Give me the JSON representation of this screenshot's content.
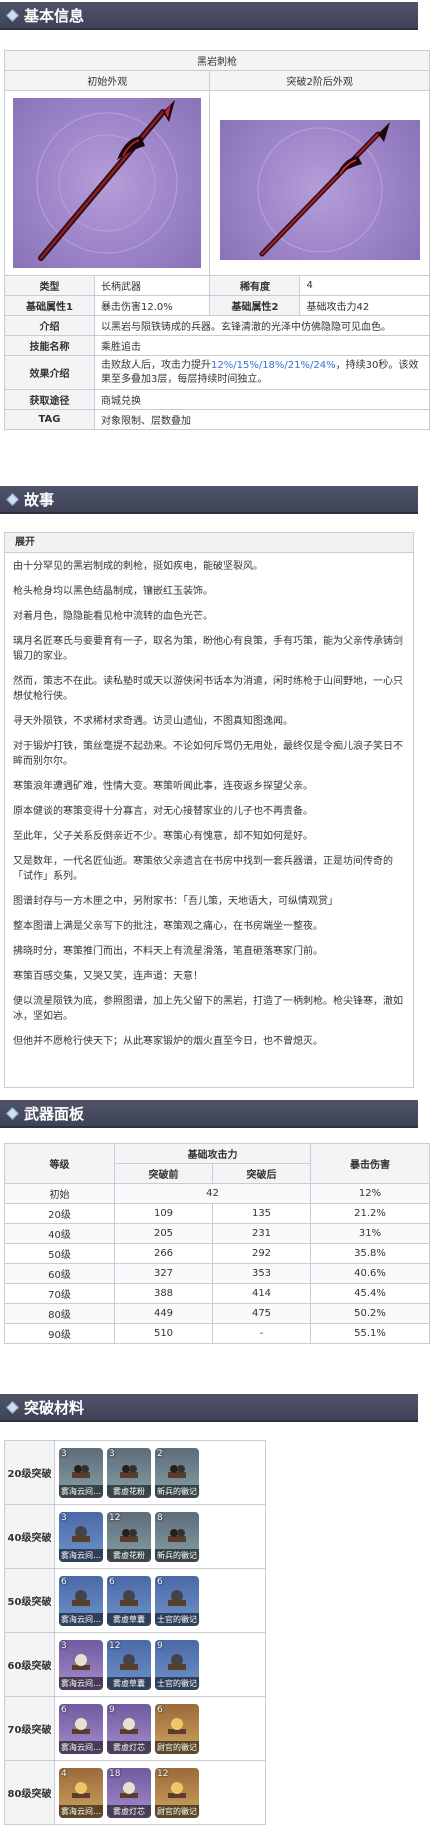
{
  "sections": {
    "basic": "基本信息",
    "story": "故事",
    "panel": "武器面板",
    "materials": "突破材料"
  },
  "info": {
    "name": "黑岩刺枪",
    "initial_label": "初始外观",
    "ascended_label": "突破2阶后外观",
    "type_label": "类型",
    "type_value": "长柄武器",
    "rarity_label": "稀有度",
    "rarity_value": "4",
    "attr1_label": "基础属性1",
    "attr1_value": "暴击伤害12.0%",
    "attr2_label": "基础属性2",
    "attr2_value": "基础攻击力42",
    "intro_label": "介绍",
    "intro_value": "以黑岩与陨铁铸成的兵器。玄锋清澈的光泽中仿佛隐隐可见血色。",
    "skill_label": "技能名称",
    "skill_value": "乘胜追击",
    "effect_label": "效果介绍",
    "effect_pre": "击败敌人后，攻击力提升",
    "effect_hl": "12%/15%/18%/21%/24%",
    "effect_post": "，持续30秒。该效果至多叠加3层，每层持续时间独立。",
    "source_label": "获取途径",
    "source_value": "商城兑换",
    "tag_label": "TAG",
    "tag_value": "对象限制、层数叠加"
  },
  "story": {
    "toggle": "展开",
    "lines": [
      "由十分罕见的黑岩制成的刺枪，挺如疾电，能破坚裂风。",
      "枪头枪身均以黑色结晶制成，镶嵌红玉装饰。",
      "对着月色，隐隐能看见枪中流转的血色光芒。",
      "璃月名匠寒氏与妾要育有一子，取名为策，盼他心有良策，手有巧策，能为父亲传承铸剑锻刀的家业。",
      "然而，策志不在此。读私塾时或天以游侠闲书话本为消遣，闲时练枪于山间野地，一心只想仗枪行侠。",
      "寻天外陨铁，不求稀材求奇遇。访灵山遗仙，不图真知图逸闻。",
      "对于锻炉打铁，策丝毫提不起劲来。不论如何斥骂仍无用处，最终仅是令痴儿浪子笑日不眸而别尔尔。",
      "寒策浪年遭遇矿难，性情大变。寒策听闻此事，连夜返乡探望父亲。",
      "原本健谈的寒策变得十分寡言，对无心接替家业的儿子也不再责备。",
      "至此年，父子关系反倒亲近不少。寒策心有愧意，却不知如何是好。",
      "又是数年，一代名匠仙逝。寒策依父亲遗言在书房中找到一套兵器谱，正是坊间传奇的「试作」系列。",
      "图谱封存与一方木匣之中，另附家书：「吾儿策，天地语大，可纵情观赏」",
      "整本图谱上满是父亲写下的批注，寒策观之痛心，在书房端坐一整夜。",
      "拂晓时分，寒策推门而出，不料天上有流星滑落，笔直砸落寒家门前。",
      "寒策百感交集，又哭又笑，连声道：天意！",
      "便以流星陨铁为底，参照图谱，加上先父留下的黑岩，打造了一柄刺枪。枪尖锋寒，澈如冰，坚如岩。",
      "但他并不愿枪行侠天下；从此寒家锻炉的烟火直至今日，也不曾熄灭。"
    ]
  },
  "stats": {
    "col_level": "等级",
    "col_atk": "基础攻击力",
    "col_before": "突破前",
    "col_after": "突破后",
    "col_crit": "暴击伤害",
    "rows": [
      {
        "level": "初始",
        "before": "42",
        "after": "",
        "crit": "12%"
      },
      {
        "level": "20级",
        "before": "109",
        "after": "135",
        "crit": "21.2%"
      },
      {
        "level": "40级",
        "before": "205",
        "after": "231",
        "crit": "31%"
      },
      {
        "level": "50级",
        "before": "266",
        "after": "292",
        "crit": "35.8%"
      },
      {
        "level": "60级",
        "before": "327",
        "after": "353",
        "crit": "40.6%"
      },
      {
        "level": "70级",
        "before": "388",
        "after": "414",
        "crit": "45.4%"
      },
      {
        "level": "80级",
        "before": "449",
        "after": "475",
        "crit": "50.2%"
      },
      {
        "level": "90级",
        "before": "510",
        "after": "-",
        "crit": "55.1%"
      }
    ]
  },
  "materials": [
    {
      "level": "20级突破",
      "items": [
        {
          "count": "3",
          "name": "雾海云间…",
          "rarity": "r2"
        },
        {
          "count": "3",
          "name": "雾虚花粉",
          "rarity": "r2"
        },
        {
          "count": "2",
          "name": "新兵的徽记",
          "rarity": "r2"
        }
      ]
    },
    {
      "level": "40级突破",
      "items": [
        {
          "count": "3",
          "name": "雾海云间…",
          "rarity": "r3"
        },
        {
          "count": "12",
          "name": "雾虚花粉",
          "rarity": "r2"
        },
        {
          "count": "8",
          "name": "新兵的徽记",
          "rarity": "r2"
        }
      ]
    },
    {
      "level": "50级突破",
      "items": [
        {
          "count": "6",
          "name": "雾海云间…",
          "rarity": "r3"
        },
        {
          "count": "6",
          "name": "雾虚草囊",
          "rarity": "r3"
        },
        {
          "count": "6",
          "name": "士官的徽记",
          "rarity": "r3"
        }
      ]
    },
    {
      "level": "60级突破",
      "items": [
        {
          "count": "3",
          "name": "雾海云间…",
          "rarity": "r4"
        },
        {
          "count": "12",
          "name": "雾虚草囊",
          "rarity": "r3"
        },
        {
          "count": "9",
          "name": "士官的徽记",
          "rarity": "r3"
        }
      ]
    },
    {
      "level": "70级突破",
      "items": [
        {
          "count": "6",
          "name": "雾海云间…",
          "rarity": "r4"
        },
        {
          "count": "9",
          "name": "雾虚灯芯",
          "rarity": "r4"
        },
        {
          "count": "6",
          "name": "尉官的徽记",
          "rarity": "r5"
        }
      ]
    },
    {
      "level": "80级突破",
      "items": [
        {
          "count": "4",
          "name": "雾海云间…",
          "rarity": "r5"
        },
        {
          "count": "18",
          "name": "雾虚灯芯",
          "rarity": "r4"
        },
        {
          "count": "12",
          "name": "尉官的徽记",
          "rarity": "r5"
        }
      ]
    }
  ]
}
